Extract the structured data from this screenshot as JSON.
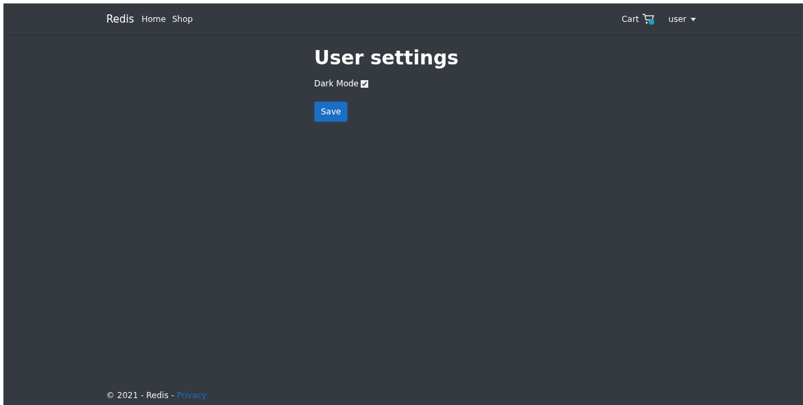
{
  "navbar": {
    "brand": "Redis",
    "links": [
      {
        "label": "Home"
      },
      {
        "label": "Shop"
      }
    ],
    "cart": {
      "label": "Cart"
    },
    "user_menu": {
      "label": "user"
    }
  },
  "page": {
    "title": "User settings",
    "settings": [
      {
        "label": "Dark Mode",
        "checked": true
      }
    ],
    "save_button": "Save"
  },
  "footer": {
    "text": "© 2021 - Redis - ",
    "link": "Privacy"
  }
}
